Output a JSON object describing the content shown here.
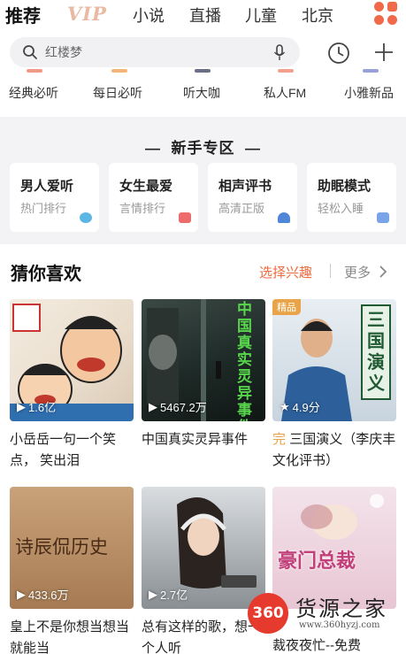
{
  "top_tabs": [
    {
      "label": "推荐",
      "active": true
    },
    {
      "label": "VIP",
      "active": false
    },
    {
      "label": "小说",
      "active": false
    },
    {
      "label": "直播",
      "active": false
    },
    {
      "label": "儿童",
      "active": false
    },
    {
      "label": "北京",
      "active": false
    }
  ],
  "search": {
    "placeholder": "红楼梦"
  },
  "quick_nav": [
    "经典必听",
    "每日必听",
    "听大咖",
    "私人FM",
    "小雅新品"
  ],
  "newbie": {
    "title": "新手专区",
    "cards": [
      {
        "title": "男人爱听",
        "subtitle": "热门排行"
      },
      {
        "title": "女生最爱",
        "subtitle": "言情排行"
      },
      {
        "title": "相声评书",
        "subtitle": "高清正版"
      },
      {
        "title": "助眠模式",
        "subtitle": "轻松入睡"
      }
    ]
  },
  "guess": {
    "title": "猜你喜欢",
    "interest_label": "选择兴趣",
    "more_label": "更多",
    "items": [
      {
        "stat": "1.6亿",
        "caption": "小岳岳一句一个笑点， 笑出泪",
        "cover_text": "",
        "badge": ""
      },
      {
        "stat": "5467.2万",
        "caption": "中国真实灵异事件",
        "cover_text": "中国真实灵异事件",
        "badge": ""
      },
      {
        "stat": "4.9分",
        "caption": "三国演义（李庆丰文化评书）",
        "prefix": "完",
        "cover_text": "三国演义",
        "badge": "精品"
      },
      {
        "stat": "433.6万",
        "caption": "皇上不是你想当想当就能当",
        "cover_text": "诗辰侃历史",
        "badge": ""
      },
      {
        "stat": "2.7亿",
        "caption": "总有这样的歌，想一个人听",
        "cover_text": "",
        "badge": ""
      },
      {
        "stat": "",
        "caption": "裁夜夜忙--免费",
        "cover_text": "豪门总裁",
        "badge": ""
      }
    ]
  },
  "watermark": {
    "logo": "360",
    "name": "货源之家",
    "url": "www.360hyzj.com"
  },
  "colors": {
    "accent": "#ef6a3d",
    "vip": "#e9b9a2",
    "gold": "#e9a44a"
  }
}
